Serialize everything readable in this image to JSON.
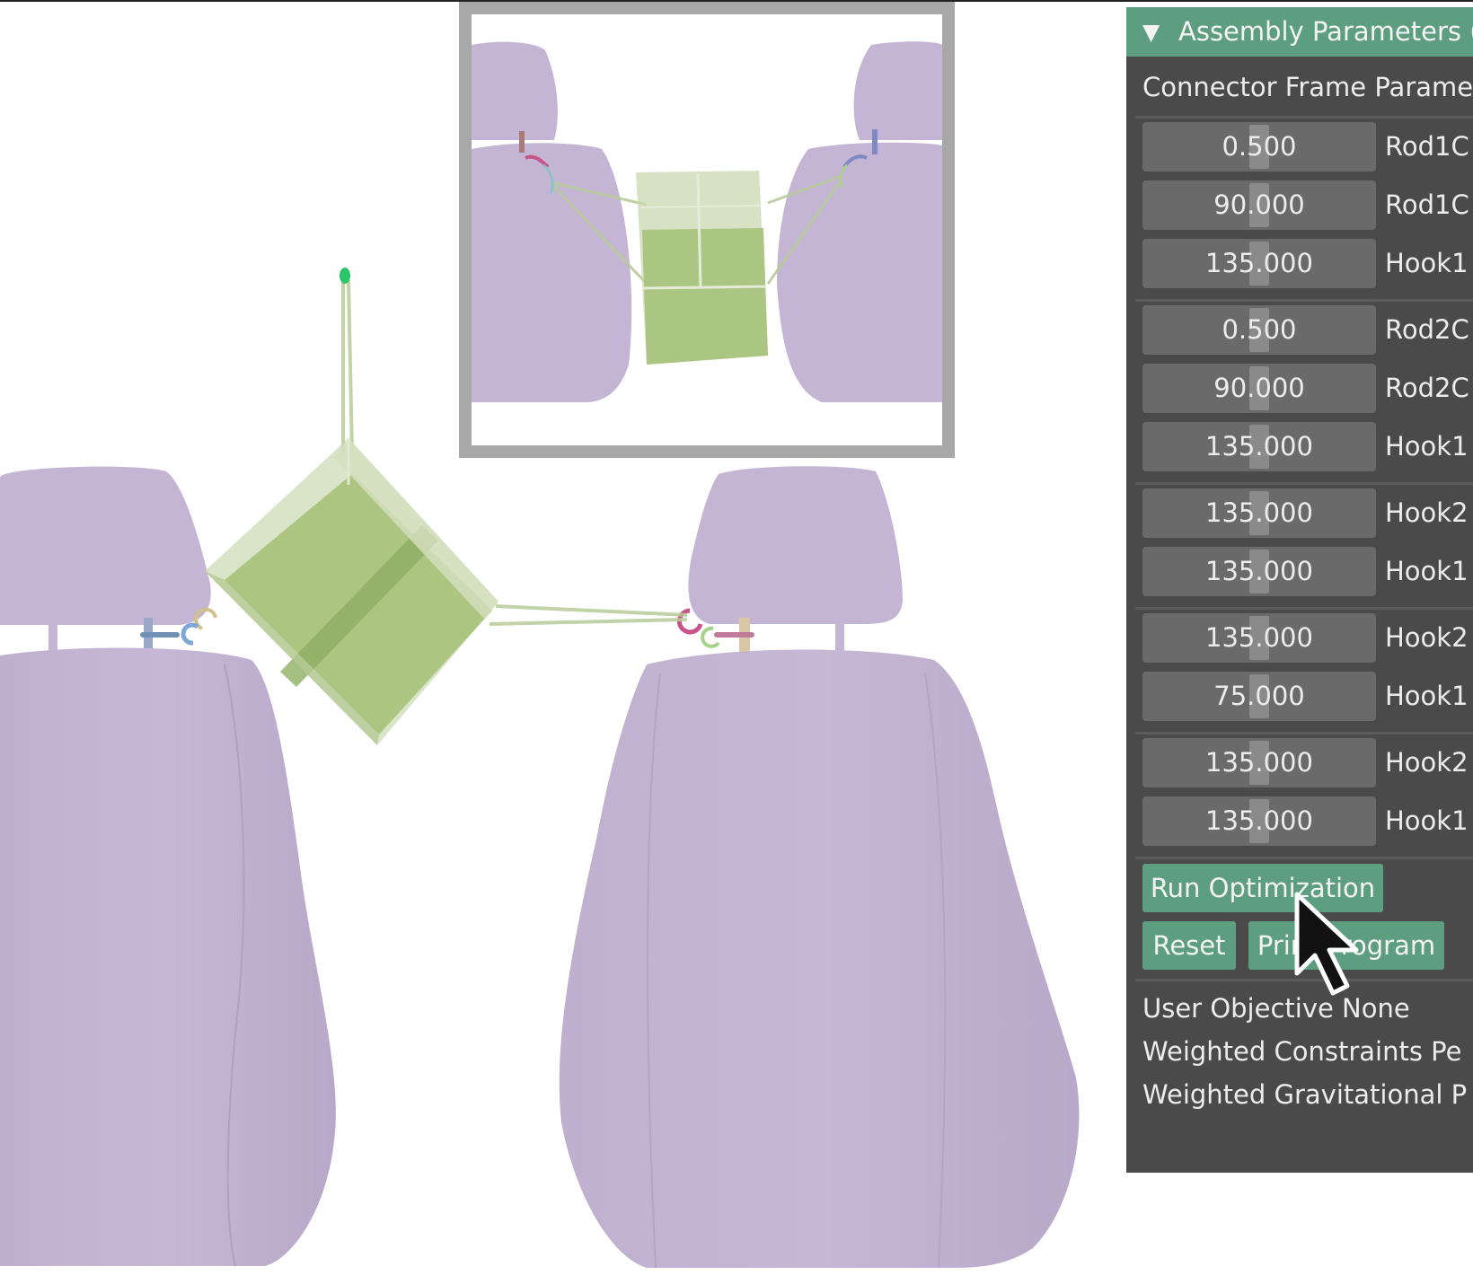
{
  "panel": {
    "title": "Assembly Parameters (",
    "collapse_glyph": "▼",
    "section_label": "Connector Frame Paramete",
    "rows": [
      {
        "value": "0.500",
        "label": "Rod1C"
      },
      {
        "value": "90.000",
        "label": "Rod1C"
      },
      {
        "value": "135.000",
        "label": "Hook1"
      },
      {
        "value": "0.500",
        "label": "Rod2C"
      },
      {
        "value": "90.000",
        "label": "Rod2C"
      },
      {
        "value": "135.000",
        "label": "Hook1"
      },
      {
        "value": "135.000",
        "label": "Hook2"
      },
      {
        "value": "135.000",
        "label": "Hook1"
      },
      {
        "value": "135.000",
        "label": "Hook2"
      },
      {
        "value": "75.000",
        "label": "Hook1"
      },
      {
        "value": "135.000",
        "label": "Hook2"
      },
      {
        "value": "135.000",
        "label": "Hook1"
      }
    ],
    "buttons": {
      "run_optimization": "Run Optimization",
      "reset": "Reset",
      "print_program": "Print Program"
    },
    "info": {
      "user_objective": "User Objective None",
      "weighted_constraints": "Weighted Constraints Pe",
      "weighted_gravitational": "Weighted Gravitational P"
    }
  },
  "colors": {
    "panel_bg": "#4a4a4a",
    "accent": "#5e9e80",
    "field_bg": "#6a6a6a",
    "seat": "#c3b4d2",
    "basket": "#a4c07a"
  },
  "icons": {
    "cursor": "mouse-pointer-icon",
    "collapse": "triangle-down-icon"
  }
}
